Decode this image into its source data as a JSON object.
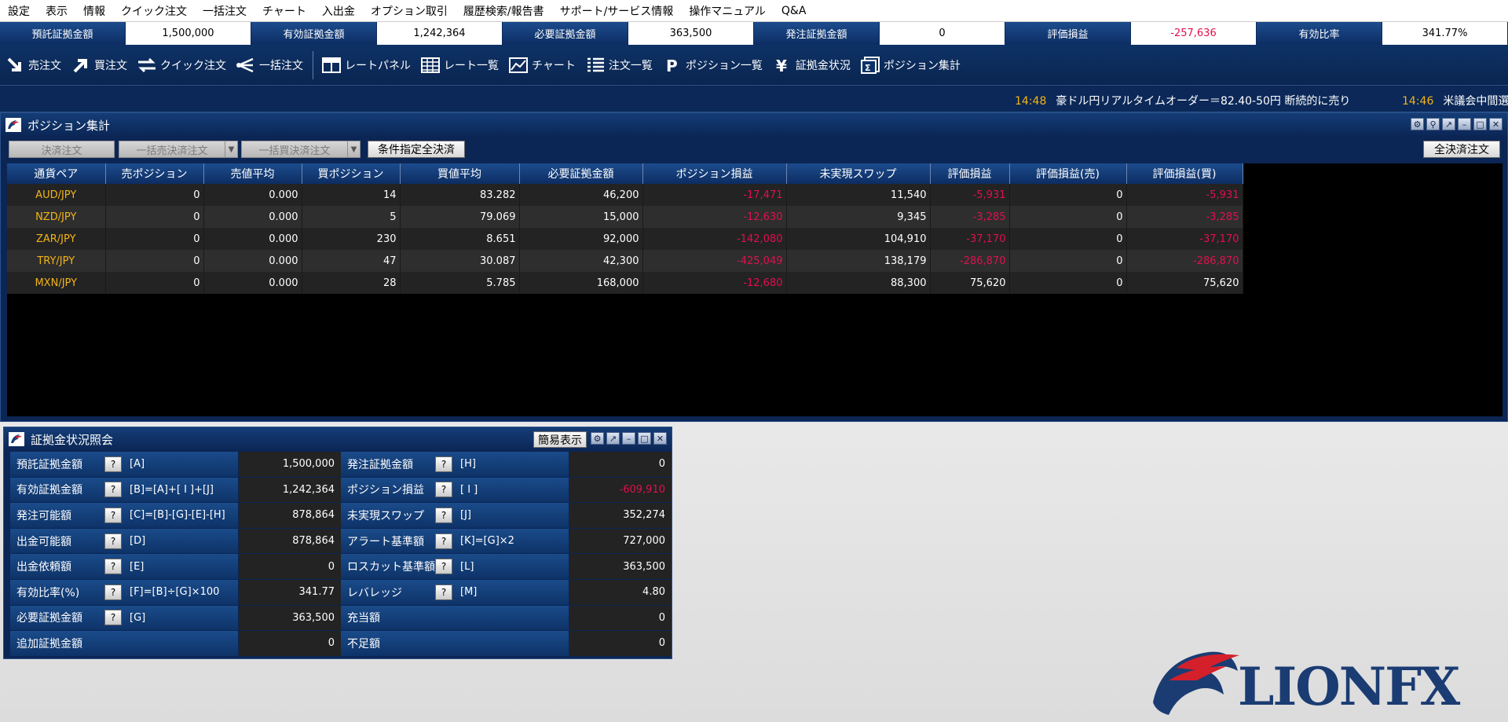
{
  "menu": [
    "設定",
    "表示",
    "情報",
    "クイック注文",
    "一括注文",
    "チャート",
    "入出金",
    "オプション取引",
    "履歴検索/報告書",
    "サポート/サービス情報",
    "操作マニュアル",
    "Q&A"
  ],
  "account": [
    {
      "label": "預託証拠金額",
      "value": "1,500,000",
      "negative": false
    },
    {
      "label": "有効証拠金額",
      "value": "1,242,364",
      "negative": false
    },
    {
      "label": "必要証拠金額",
      "value": "363,500",
      "negative": false
    },
    {
      "label": "発注証拠金額",
      "value": "0",
      "negative": false
    },
    {
      "label": "評価損益",
      "value": "-257,636",
      "negative": true
    },
    {
      "label": "有効比率",
      "value": "341.77%",
      "negative": false
    }
  ],
  "toolbar": [
    {
      "label": "売注文",
      "icon": "sell-arrow-icon"
    },
    {
      "label": "買注文",
      "icon": "buy-arrow-icon"
    },
    {
      "label": "クイック注文",
      "icon": "quick-order-icon"
    },
    {
      "label": "一括注文",
      "icon": "bulk-order-icon"
    },
    {
      "label": "レートパネル",
      "icon": "rate-panel-icon"
    },
    {
      "label": "レート一覧",
      "icon": "rate-list-icon"
    },
    {
      "label": "チャート",
      "icon": "chart-icon"
    },
    {
      "label": "注文一覧",
      "icon": "order-list-icon"
    },
    {
      "label": "ポジション一覧",
      "icon": "position-list-icon"
    },
    {
      "label": "証拠金状況",
      "icon": "yen-icon"
    },
    {
      "label": "ポジション集計",
      "icon": "position-summary-icon"
    }
  ],
  "ticker": [
    {
      "time": "14:48",
      "text": "豪ドル円リアルタイムオーダー＝82.40-50円 断続的に売り"
    },
    {
      "time": "14:46",
      "text": "米議会中間選"
    }
  ],
  "position_window": {
    "title": "ポジション集計",
    "buttons": {
      "settle": "決済注文",
      "bulk_sell": "一括売決済注文",
      "bulk_buy": "一括買決済注文",
      "conditional": "条件指定全決済",
      "settle_all": "全決済注文"
    },
    "columns": [
      "通貨ペア",
      "売ポジション",
      "売値平均",
      "買ポジション",
      "買値平均",
      "必要証拠金額",
      "ポジション損益",
      "未実現スワップ",
      "評価損益",
      "評価損益(売)",
      "評価損益(買)"
    ],
    "rows": [
      [
        "AUD/JPY",
        "0",
        "0.000",
        "14",
        "83.282",
        "46,200",
        "-17,471",
        "11,540",
        "-5,931",
        "0",
        "-5,931"
      ],
      [
        "NZD/JPY",
        "0",
        "0.000",
        "5",
        "79.069",
        "15,000",
        "-12,630",
        "9,345",
        "-3,285",
        "0",
        "-3,285"
      ],
      [
        "ZAR/JPY",
        "0",
        "0.000",
        "230",
        "8.651",
        "92,000",
        "-142,080",
        "104,910",
        "-37,170",
        "0",
        "-37,170"
      ],
      [
        "TRY/JPY",
        "0",
        "0.000",
        "47",
        "30.087",
        "42,300",
        "-425,049",
        "138,179",
        "-286,870",
        "0",
        "-286,870"
      ],
      [
        "MXN/JPY",
        "0",
        "0.000",
        "28",
        "5.785",
        "168,000",
        "-12,680",
        "88,300",
        "75,620",
        "0",
        "75,620"
      ]
    ]
  },
  "margin_window": {
    "title": "証拠金状況照会",
    "simple_button": "簡易表示",
    "left": [
      {
        "label": "預託証拠金額",
        "formula": "[A]",
        "value": "1,500,000",
        "help": "?"
      },
      {
        "label": "有効証拠金額",
        "formula": "[B]=[A]+[ I ]+[J]",
        "value": "1,242,364",
        "help": "?"
      },
      {
        "label": "発注可能額",
        "formula": "[C]=[B]-[G]-[E]-[H]",
        "value": "878,864",
        "help": "?"
      },
      {
        "label": "出金可能額",
        "formula": "[D]",
        "value": "878,864",
        "help": "?"
      },
      {
        "label": "出金依頼額",
        "formula": "[E]",
        "value": "0",
        "help": "?"
      },
      {
        "label": "有効比率(%)",
        "formula": "[F]=[B]÷[G]×100",
        "value": "341.77",
        "help": "?"
      },
      {
        "label": "必要証拠金額",
        "formula": "[G]",
        "value": "363,500",
        "help": "?"
      },
      {
        "label": "追加証拠金額",
        "formula": "",
        "value": "0",
        "help": ""
      }
    ],
    "right": [
      {
        "label": "発注証拠金額",
        "formula": "[H]",
        "value": "0",
        "help": "?"
      },
      {
        "label": "ポジション損益",
        "formula": "[ I ]",
        "value": "-609,910",
        "help": "?"
      },
      {
        "label": "未実現スワップ",
        "formula": "[J]",
        "value": "352,274",
        "help": "?"
      },
      {
        "label": "アラート基準額",
        "formula": "[K]=[G]×2",
        "value": "727,000",
        "help": "?"
      },
      {
        "label": "ロスカット基準額",
        "formula": "[L]",
        "value": "363,500",
        "help": "?"
      },
      {
        "label": "レバレッジ",
        "formula": "[M]",
        "value": "4.80",
        "help": "?"
      },
      {
        "label": "充当額",
        "formula": "",
        "value": "0",
        "help": ""
      },
      {
        "label": "不足額",
        "formula": "",
        "value": "0",
        "help": ""
      }
    ]
  },
  "logo_text": "LIONFX",
  "colors": {
    "navy": "#0b2655",
    "negative": "#e0104e",
    "pair": "#f3b417",
    "logo_red": "#d4202a"
  }
}
